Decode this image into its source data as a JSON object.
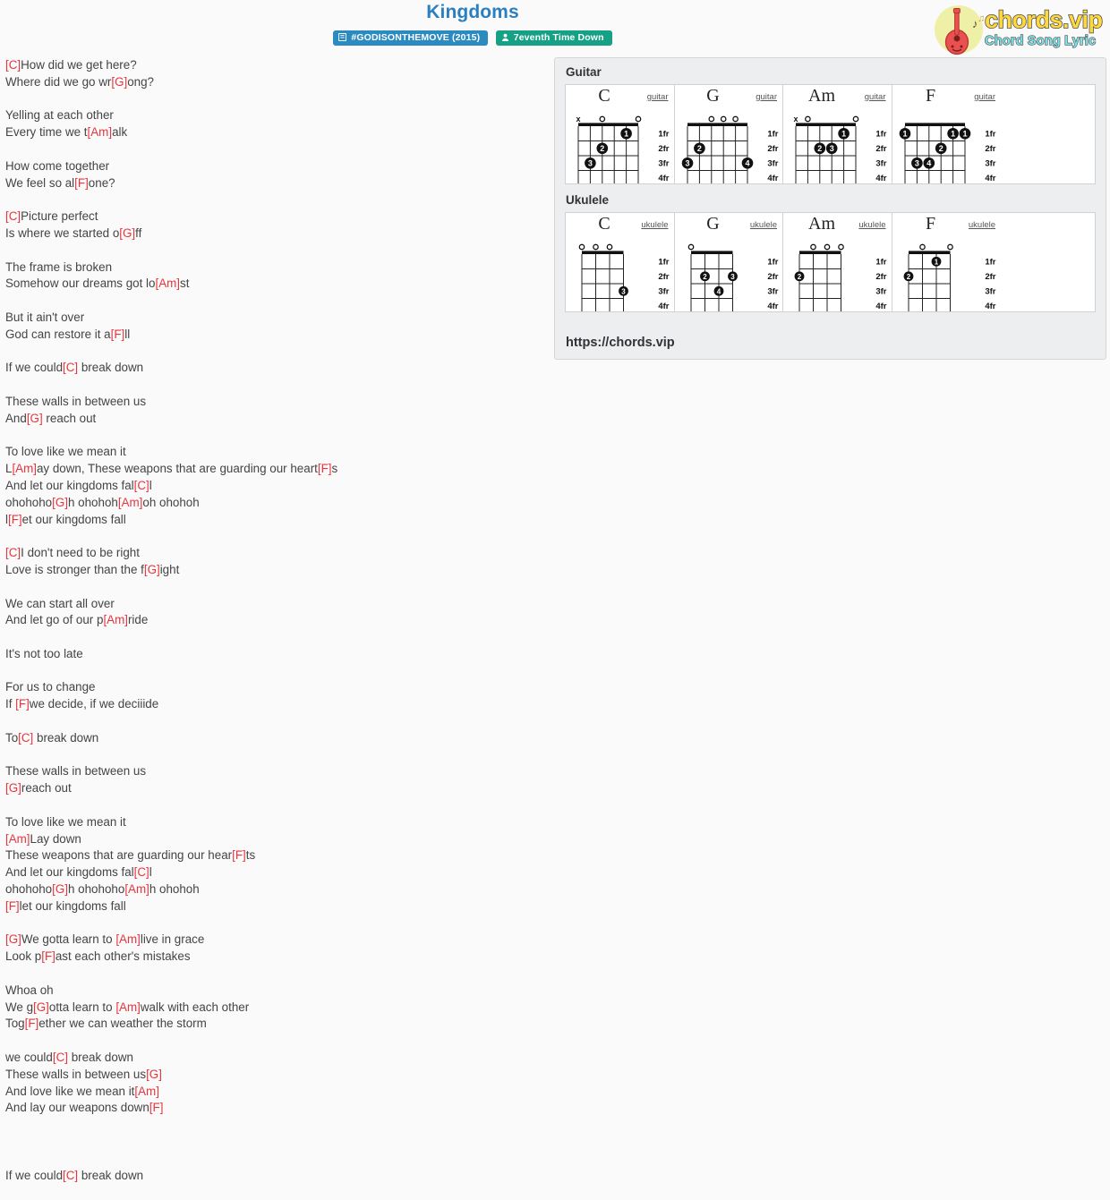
{
  "header": {
    "title": "Kingdoms",
    "album_badge": "#GODISONTHEMOVE (2015)",
    "artist_badge": "7eventh Time Down",
    "album_icon": "album-icon",
    "artist_icon": "user-icon"
  },
  "logo": {
    "main": "chords.vip",
    "sub": "Chord Song Lyric",
    "icon": "guitar-icon"
  },
  "lyrics": {
    "blocks": [
      [
        {
          "t": "[C]",
          "c": true
        },
        {
          "t": "How did we get here?",
          "c": false
        }
      ],
      [
        {
          "t": "Where did we go wr",
          "c": false
        },
        {
          "t": "[G]",
          "c": true
        },
        {
          "t": "ong?",
          "c": false
        }
      ],
      [],
      [
        {
          "t": "Yelling at each other",
          "c": false
        }
      ],
      [
        {
          "t": "Every time we t",
          "c": false
        },
        {
          "t": "[Am]",
          "c": true
        },
        {
          "t": "alk",
          "c": false
        }
      ],
      [],
      [
        {
          "t": "How come together",
          "c": false
        }
      ],
      [
        {
          "t": "We feel so al",
          "c": false
        },
        {
          "t": "[F]",
          "c": true
        },
        {
          "t": "one?",
          "c": false
        }
      ],
      [],
      [
        {
          "t": "[C]",
          "c": true
        },
        {
          "t": "Picture perfect",
          "c": false
        }
      ],
      [
        {
          "t": "Is where we started o",
          "c": false
        },
        {
          "t": "[G]",
          "c": true
        },
        {
          "t": "ff",
          "c": false
        }
      ],
      [],
      [
        {
          "t": "The frame is broken",
          "c": false
        }
      ],
      [
        {
          "t": "Somehow our dreams got lo",
          "c": false
        },
        {
          "t": "[Am]",
          "c": true
        },
        {
          "t": "st",
          "c": false
        }
      ],
      [],
      [
        {
          "t": "But it ain't over",
          "c": false
        }
      ],
      [
        {
          "t": "God can restore it a",
          "c": false
        },
        {
          "t": "[F]",
          "c": true
        },
        {
          "t": "ll",
          "c": false
        }
      ],
      [],
      [
        {
          "t": "If we could",
          "c": false
        },
        {
          "t": "[C]",
          "c": true
        },
        {
          "t": " break down",
          "c": false
        }
      ],
      [],
      [
        {
          "t": "These walls in between us",
          "c": false
        }
      ],
      [
        {
          "t": "And",
          "c": false
        },
        {
          "t": "[G]",
          "c": true
        },
        {
          "t": " reach out",
          "c": false
        }
      ],
      [],
      [
        {
          "t": "To love like we mean it",
          "c": false
        }
      ],
      [
        {
          "t": "L",
          "c": false
        },
        {
          "t": "[Am]",
          "c": true
        },
        {
          "t": "ay down, These weapons that are guarding our heart",
          "c": false
        },
        {
          "t": "[F]",
          "c": true
        },
        {
          "t": "s",
          "c": false
        }
      ],
      [
        {
          "t": "And let our kingdoms fal",
          "c": false
        },
        {
          "t": "[C]",
          "c": true
        },
        {
          "t": "l",
          "c": false
        }
      ],
      [
        {
          "t": "ohohoho",
          "c": false
        },
        {
          "t": "[G]",
          "c": true
        },
        {
          "t": "h ohohoh",
          "c": false
        },
        {
          "t": "[Am]",
          "c": true
        },
        {
          "t": "oh ohohoh",
          "c": false
        }
      ],
      [
        {
          "t": "l",
          "c": false
        },
        {
          "t": "[F]",
          "c": true
        },
        {
          "t": "et our kingdoms fall",
          "c": false
        }
      ],
      [],
      [
        {
          "t": "[C]",
          "c": true
        },
        {
          "t": "I don't need to be right",
          "c": false
        }
      ],
      [
        {
          "t": "Love is stronger than the f",
          "c": false
        },
        {
          "t": "[G]",
          "c": true
        },
        {
          "t": "ight",
          "c": false
        }
      ],
      [],
      [
        {
          "t": "We can start all over",
          "c": false
        }
      ],
      [
        {
          "t": "And let go of our p",
          "c": false
        },
        {
          "t": "[Am]",
          "c": true
        },
        {
          "t": "ride",
          "c": false
        }
      ],
      [],
      [
        {
          "t": "It's not too late",
          "c": false
        }
      ],
      [],
      [
        {
          "t": "For us to change",
          "c": false
        }
      ],
      [
        {
          "t": "If ",
          "c": false
        },
        {
          "t": "[F]",
          "c": true
        },
        {
          "t": "we decide, if we deciiide",
          "c": false
        }
      ],
      [],
      [
        {
          "t": "To",
          "c": false
        },
        {
          "t": "[C]",
          "c": true
        },
        {
          "t": " break down",
          "c": false
        }
      ],
      [],
      [
        {
          "t": "These walls in between us",
          "c": false
        }
      ],
      [
        {
          "t": "[G]",
          "c": true
        },
        {
          "t": "reach out",
          "c": false
        }
      ],
      [],
      [
        {
          "t": "To love like we mean it",
          "c": false
        }
      ],
      [
        {
          "t": "[Am]",
          "c": true
        },
        {
          "t": "Lay down",
          "c": false
        }
      ],
      [
        {
          "t": "These weapons that are guarding our hear",
          "c": false
        },
        {
          "t": "[F]",
          "c": true
        },
        {
          "t": "ts",
          "c": false
        }
      ],
      [
        {
          "t": "And let our kingdoms fal",
          "c": false
        },
        {
          "t": "[C]",
          "c": true
        },
        {
          "t": "l",
          "c": false
        }
      ],
      [
        {
          "t": "ohohoho",
          "c": false
        },
        {
          "t": "[G]",
          "c": true
        },
        {
          "t": "h ohohoho",
          "c": false
        },
        {
          "t": "[Am]",
          "c": true
        },
        {
          "t": "h ohohoh",
          "c": false
        }
      ],
      [
        {
          "t": "[F]",
          "c": true
        },
        {
          "t": "let our kingdoms fall",
          "c": false
        }
      ],
      [],
      [
        {
          "t": "[G]",
          "c": true
        },
        {
          "t": "We gotta learn to ",
          "c": false
        },
        {
          "t": "[Am]",
          "c": true
        },
        {
          "t": "live in grace",
          "c": false
        }
      ],
      [
        {
          "t": "Look p",
          "c": false
        },
        {
          "t": "[F]",
          "c": true
        },
        {
          "t": "ast each other's mistakes",
          "c": false
        }
      ],
      [],
      [
        {
          "t": "Whoa oh",
          "c": false
        }
      ],
      [
        {
          "t": "We g",
          "c": false
        },
        {
          "t": "[G]",
          "c": true
        },
        {
          "t": "otta learn to ",
          "c": false
        },
        {
          "t": "[Am]",
          "c": true
        },
        {
          "t": "walk with each other",
          "c": false
        }
      ],
      [
        {
          "t": "Tog",
          "c": false
        },
        {
          "t": "[F]",
          "c": true
        },
        {
          "t": "ether we can weather the storm",
          "c": false
        }
      ],
      [],
      [
        {
          "t": "we could",
          "c": false
        },
        {
          "t": "[C]",
          "c": true
        },
        {
          "t": " break down",
          "c": false
        }
      ],
      [
        {
          "t": "These walls in between us",
          "c": false
        },
        {
          "t": "[G]",
          "c": true
        }
      ],
      [
        {
          "t": "And love like we mean it",
          "c": false
        },
        {
          "t": "[Am]",
          "c": true
        }
      ],
      [
        {
          "t": "And lay our weapons down",
          "c": false
        },
        {
          "t": "[F]",
          "c": true
        }
      ],
      [],
      [],
      [],
      [
        {
          "t": "If we could",
          "c": false
        },
        {
          "t": "[C]",
          "c": true
        },
        {
          "t": " break down",
          "c": false
        }
      ]
    ]
  },
  "chords_panel": {
    "guitar_label": "Guitar",
    "ukulele_label": "Ukulele",
    "url": "https://chords.vip",
    "fret_labels": [
      "1fr",
      "2fr",
      "3fr",
      "4fr"
    ],
    "guitar": [
      {
        "name": "C",
        "instrument": "guitar",
        "strings": 6,
        "open": [
          "x",
          "",
          "o",
          "",
          "",
          "o"
        ],
        "dots": [
          {
            "string": 2,
            "fret": 1,
            "finger": "1"
          },
          {
            "string": 4,
            "fret": 2,
            "finger": "2"
          },
          {
            "string": 5,
            "fret": 3,
            "finger": "3"
          }
        ]
      },
      {
        "name": "G",
        "instrument": "guitar",
        "strings": 6,
        "open": [
          "",
          "",
          "o",
          "o",
          "o",
          ""
        ],
        "dots": [
          {
            "string": 5,
            "fret": 2,
            "finger": "2"
          },
          {
            "string": 6,
            "fret": 3,
            "finger": "3"
          },
          {
            "string": 1,
            "fret": 3,
            "finger": "4"
          }
        ]
      },
      {
        "name": "Am",
        "instrument": "guitar",
        "strings": 6,
        "open": [
          "x",
          "o",
          "",
          "",
          "",
          "o"
        ],
        "dots": [
          {
            "string": 2,
            "fret": 1,
            "finger": "1"
          },
          {
            "string": 4,
            "fret": 2,
            "finger": "2"
          },
          {
            "string": 3,
            "fret": 2,
            "finger": "3"
          }
        ]
      },
      {
        "name": "F",
        "instrument": "guitar",
        "strings": 6,
        "open": [
          "",
          "",
          "",
          "",
          "",
          ""
        ],
        "dots": [
          {
            "string": 6,
            "fret": 1,
            "finger": "1"
          },
          {
            "string": 2,
            "fret": 1,
            "finger": "1"
          },
          {
            "string": 1,
            "fret": 1,
            "finger": "1"
          },
          {
            "string": 3,
            "fret": 2,
            "finger": "2"
          },
          {
            "string": 5,
            "fret": 3,
            "finger": "3"
          },
          {
            "string": 4,
            "fret": 3,
            "finger": "4"
          }
        ]
      }
    ],
    "ukulele": [
      {
        "name": "C",
        "instrument": "ukulele",
        "strings": 4,
        "open": [
          "o",
          "o",
          "o",
          ""
        ],
        "dots": [
          {
            "string": 1,
            "fret": 3,
            "finger": "3"
          }
        ]
      },
      {
        "name": "G",
        "instrument": "ukulele",
        "strings": 4,
        "open": [
          "o",
          "",
          "",
          ""
        ],
        "dots": [
          {
            "string": 3,
            "fret": 2,
            "finger": "2"
          },
          {
            "string": 1,
            "fret": 2,
            "finger": "3"
          },
          {
            "string": 2,
            "fret": 3,
            "finger": "4"
          }
        ]
      },
      {
        "name": "Am",
        "instrument": "ukulele",
        "strings": 4,
        "open": [
          "",
          "o",
          "o",
          "o"
        ],
        "dots": [
          {
            "string": 4,
            "fret": 2,
            "finger": "2"
          }
        ]
      },
      {
        "name": "F",
        "instrument": "ukulele",
        "strings": 4,
        "open": [
          "",
          "o",
          "",
          "o"
        ],
        "dots": [
          {
            "string": 2,
            "fret": 1,
            "finger": "1"
          },
          {
            "string": 4,
            "fret": 2,
            "finger": "2"
          }
        ]
      }
    ]
  },
  "colors": {
    "title": "#2a7fc0",
    "chord": "#e8353e",
    "album_badge": "#2b8ac0",
    "artist_badge": "#16a085",
    "panel_bg": "#eceef0"
  }
}
